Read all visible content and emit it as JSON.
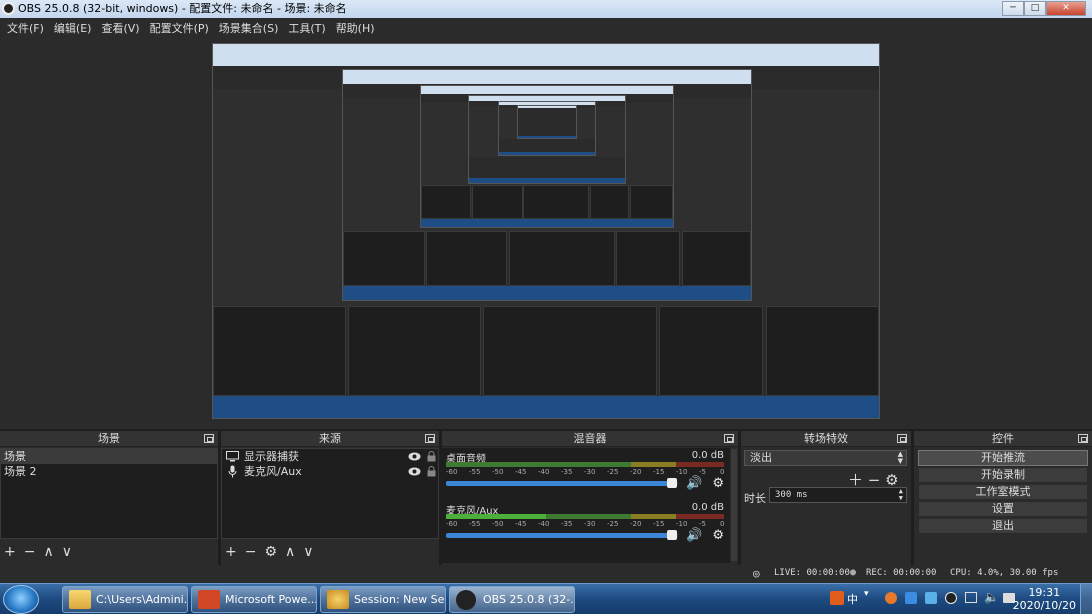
{
  "window": {
    "title": "OBS 25.0.8 (32-bit, windows) - 配置文件: 未命名 - 场景: 未命名",
    "controls": [
      "─",
      "□",
      "✕"
    ]
  },
  "menu": [
    "文件(F)",
    "编辑(E)",
    "查看(V)",
    "配置文件(P)",
    "场景集合(S)",
    "工具(T)",
    "帮助(H)"
  ],
  "scenes": {
    "title": "场景",
    "items": [
      "场景",
      "场景 2"
    ],
    "tools": [
      "+",
      "−",
      "∧",
      "∨"
    ]
  },
  "sources": {
    "title": "来源",
    "items": [
      {
        "label": "显示器捕获",
        "icon": "monitor-icon"
      },
      {
        "label": "麦克风/Aux",
        "icon": "microphone-icon"
      }
    ],
    "tools": [
      "+",
      "−",
      "⚙",
      "∧",
      "∨"
    ]
  },
  "mixer": {
    "title": "混音器",
    "channels": [
      {
        "name": "桌面音频",
        "db": "0.0 dB"
      },
      {
        "name": "麦克风/Aux",
        "db": "0.0 dB"
      }
    ],
    "scale": [
      "-60",
      "-55",
      "-50",
      "-45",
      "-40",
      "-35",
      "-30",
      "-25",
      "-20",
      "-15",
      "-10",
      "-5",
      "0"
    ]
  },
  "transitions": {
    "title": "转场特效",
    "selected": "淡出",
    "duration_label": "时长",
    "duration_value": "300 ms"
  },
  "controls": {
    "title": "控件",
    "buttons": [
      "开始推流",
      "开始录制",
      "工作室模式",
      "设置",
      "退出"
    ]
  },
  "status": {
    "live": "LIVE: 00:00:00",
    "rec": "REC: 00:00:00",
    "cpu": "CPU: 4.0%, 30.00 fps"
  },
  "taskbar": {
    "items": [
      {
        "label": "C:\\Users\\Admini...",
        "icon": "folder-icon"
      },
      {
        "label": "Microsoft Powe...",
        "icon": "powerpoint-icon"
      },
      {
        "label": "Session: New Se...",
        "icon": "session-icon"
      },
      {
        "label": "OBS 25.0.8 (32-...",
        "icon": "obs-icon"
      }
    ],
    "ime": "中",
    "time": "19:31",
    "date": "2020/10/20"
  },
  "colors": {
    "meter_green": "#4caf3a",
    "meter_yellow": "#c8b62a",
    "meter_red": "#c83a2a",
    "fader_blue": "#3b86d6"
  }
}
